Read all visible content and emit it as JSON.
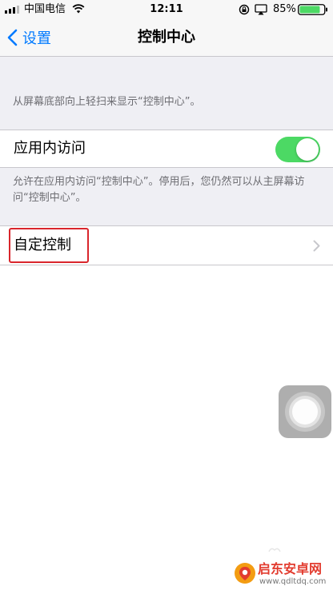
{
  "status_bar": {
    "carrier": "中国电信",
    "time": "12:11",
    "battery": "85%"
  },
  "nav": {
    "back_label": "设置",
    "title": "控制中心"
  },
  "sections": {
    "swipe_footer": "从屏幕底部向上轻扫来显示“控制中心”。",
    "access_label": "应用内访问",
    "access_toggle_on": true,
    "access_footer": "允许在应用内访问“控制中心”。停用后，您仍然可以从主屏幕访问“控制中心”。",
    "customize_label": "自定控制"
  },
  "watermark": {
    "title": "启东安卓网",
    "url": "www.qdltdq.com"
  },
  "colors": {
    "accent": "#007aff",
    "toggle_on": "#4cd964",
    "highlight_border": "#d9262c",
    "grouped_background": "#efeff4",
    "footer_text": "#6d6d72",
    "watermark_red": "#e23b2e"
  },
  "icons": {
    "signal": "signal-bars-icon",
    "wifi": "wifi-icon",
    "rotation_lock": "rotation-lock-icon",
    "airplay": "airplay-icon",
    "battery": "battery-icon",
    "back": "chevron-left-icon",
    "disclosure": "chevron-right-icon",
    "assistive_touch": "assistive-touch-icon",
    "watermark_logo": "watermark-logo-icon"
  }
}
